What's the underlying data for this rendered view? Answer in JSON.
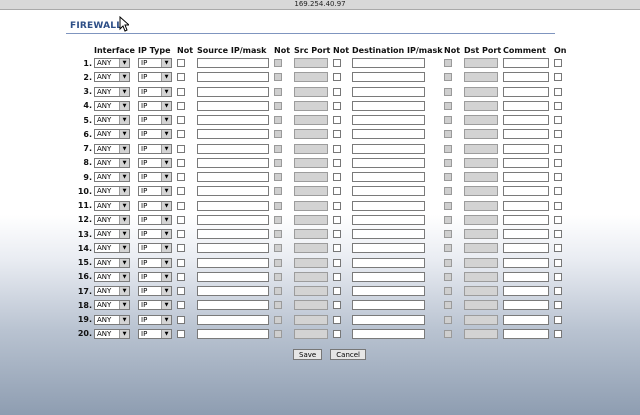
{
  "window": {
    "url": "169.254.40.97"
  },
  "page": {
    "title": "FIREWALL"
  },
  "headers": {
    "interface": "Interface",
    "ip_type": "IP Type",
    "not1": "Not",
    "source": "Source IP/mask",
    "not2": "Not",
    "src_port": "Src Port",
    "not3": "Not",
    "destination": "Destination IP/mask",
    "not4": "Not",
    "dst_port": "Dst Port",
    "comment": "Comment",
    "on": "On"
  },
  "rows": [
    {
      "num": "1.",
      "interface": "ANY",
      "ip_type": "IP"
    },
    {
      "num": "2.",
      "interface": "ANY",
      "ip_type": "IP"
    },
    {
      "num": "3.",
      "interface": "ANY",
      "ip_type": "IP"
    },
    {
      "num": "4.",
      "interface": "ANY",
      "ip_type": "IP"
    },
    {
      "num": "5.",
      "interface": "ANY",
      "ip_type": "IP"
    },
    {
      "num": "6.",
      "interface": "ANY",
      "ip_type": "IP"
    },
    {
      "num": "7.",
      "interface": "ANY",
      "ip_type": "IP"
    },
    {
      "num": "8.",
      "interface": "ANY",
      "ip_type": "IP"
    },
    {
      "num": "9.",
      "interface": "ANY",
      "ip_type": "IP"
    },
    {
      "num": "10.",
      "interface": "ANY",
      "ip_type": "IP"
    },
    {
      "num": "11.",
      "interface": "ANY",
      "ip_type": "IP"
    },
    {
      "num": "12.",
      "interface": "ANY",
      "ip_type": "IP"
    },
    {
      "num": "13.",
      "interface": "ANY",
      "ip_type": "IP"
    },
    {
      "num": "14.",
      "interface": "ANY",
      "ip_type": "IP"
    },
    {
      "num": "15.",
      "interface": "ANY",
      "ip_type": "IP"
    },
    {
      "num": "16.",
      "interface": "ANY",
      "ip_type": "IP"
    },
    {
      "num": "17.",
      "interface": "ANY",
      "ip_type": "IP"
    },
    {
      "num": "18.",
      "interface": "ANY",
      "ip_type": "IP"
    },
    {
      "num": "19.",
      "interface": "ANY",
      "ip_type": "IP"
    },
    {
      "num": "20.",
      "interface": "ANY",
      "ip_type": "IP"
    }
  ],
  "buttons": {
    "save": "Save",
    "cancel": "Cancel"
  },
  "colors": {
    "heading": "#2d4e86",
    "rule": "#7f95bf",
    "disabled_field": "#d3d3d3"
  }
}
